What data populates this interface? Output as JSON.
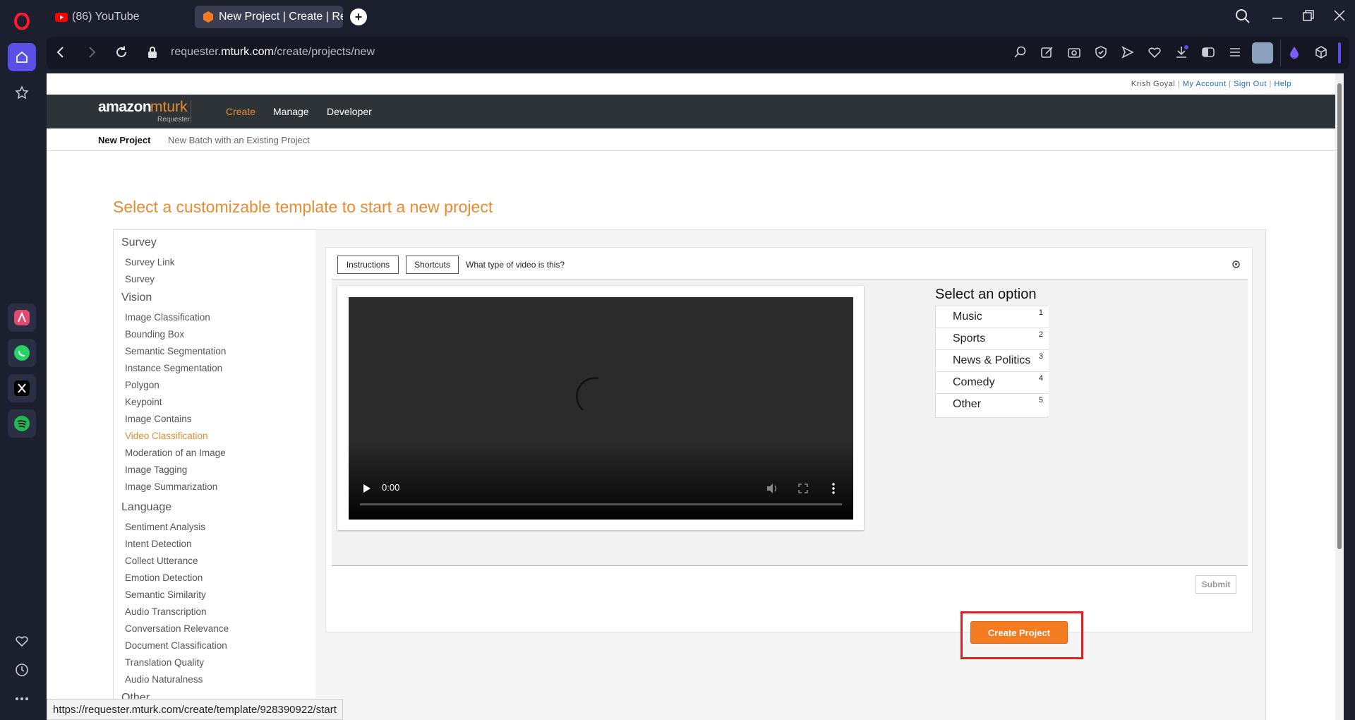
{
  "browser": {
    "tabs": [
      {
        "label": "(86) YouTube"
      },
      {
        "label": "New Project | Create | Req"
      }
    ],
    "url_prefix": "requester.",
    "url_domain": "mturk.com",
    "url_path": "/create/projects/new",
    "status_url": "https://requester.mturk.com/create/template/928390922/start"
  },
  "topstrip": {
    "user": "Krish Goyal",
    "my_account": "My Account",
    "sign_out": "Sign Out",
    "help": "Help",
    "sep": "|"
  },
  "nav": {
    "logo_amazon": "amazon",
    "logo_mturk": "mturk",
    "logo_sub": "Requester",
    "items": [
      "Create",
      "Manage",
      "Developer"
    ]
  },
  "subnav": {
    "items": [
      "New Project",
      "New Batch with an Existing Project"
    ]
  },
  "heading": "Select a customizable template to start a new project",
  "templates": {
    "survey": {
      "title": "Survey",
      "items": [
        "Survey Link",
        "Survey"
      ]
    },
    "vision": {
      "title": "Vision",
      "items": [
        "Image Classification",
        "Bounding Box",
        "Semantic Segmentation",
        "Instance Segmentation",
        "Polygon",
        "Keypoint",
        "Image Contains",
        "Video Classification",
        "Moderation of an Image",
        "Image Tagging",
        "Image Summarization"
      ]
    },
    "language": {
      "title": "Language",
      "items": [
        "Sentiment Analysis",
        "Intent Detection",
        "Collect Utterance",
        "Emotion Detection",
        "Semantic Similarity",
        "Audio Transcription",
        "Conversation Relevance",
        "Document Classification",
        "Translation Quality",
        "Audio Naturalness"
      ]
    },
    "other": {
      "title": "Other"
    }
  },
  "preview": {
    "instructions": "Instructions",
    "shortcuts": "Shortcuts",
    "question": "What type of video is this?",
    "video_time": "0:00",
    "select_title": "Select an option",
    "options": [
      {
        "label": "Music",
        "key": "1"
      },
      {
        "label": "Sports",
        "key": "2"
      },
      {
        "label": "News & Politics",
        "key": "3"
      },
      {
        "label": "Comedy",
        "key": "4"
      },
      {
        "label": "Other",
        "key": "5"
      }
    ],
    "submit": "Submit"
  },
  "create_button": "Create Project",
  "colors": {
    "accent": "#e88b2f",
    "button": "#f47b20",
    "highlight": "#e02020",
    "nav_bg": "#2e3338"
  }
}
